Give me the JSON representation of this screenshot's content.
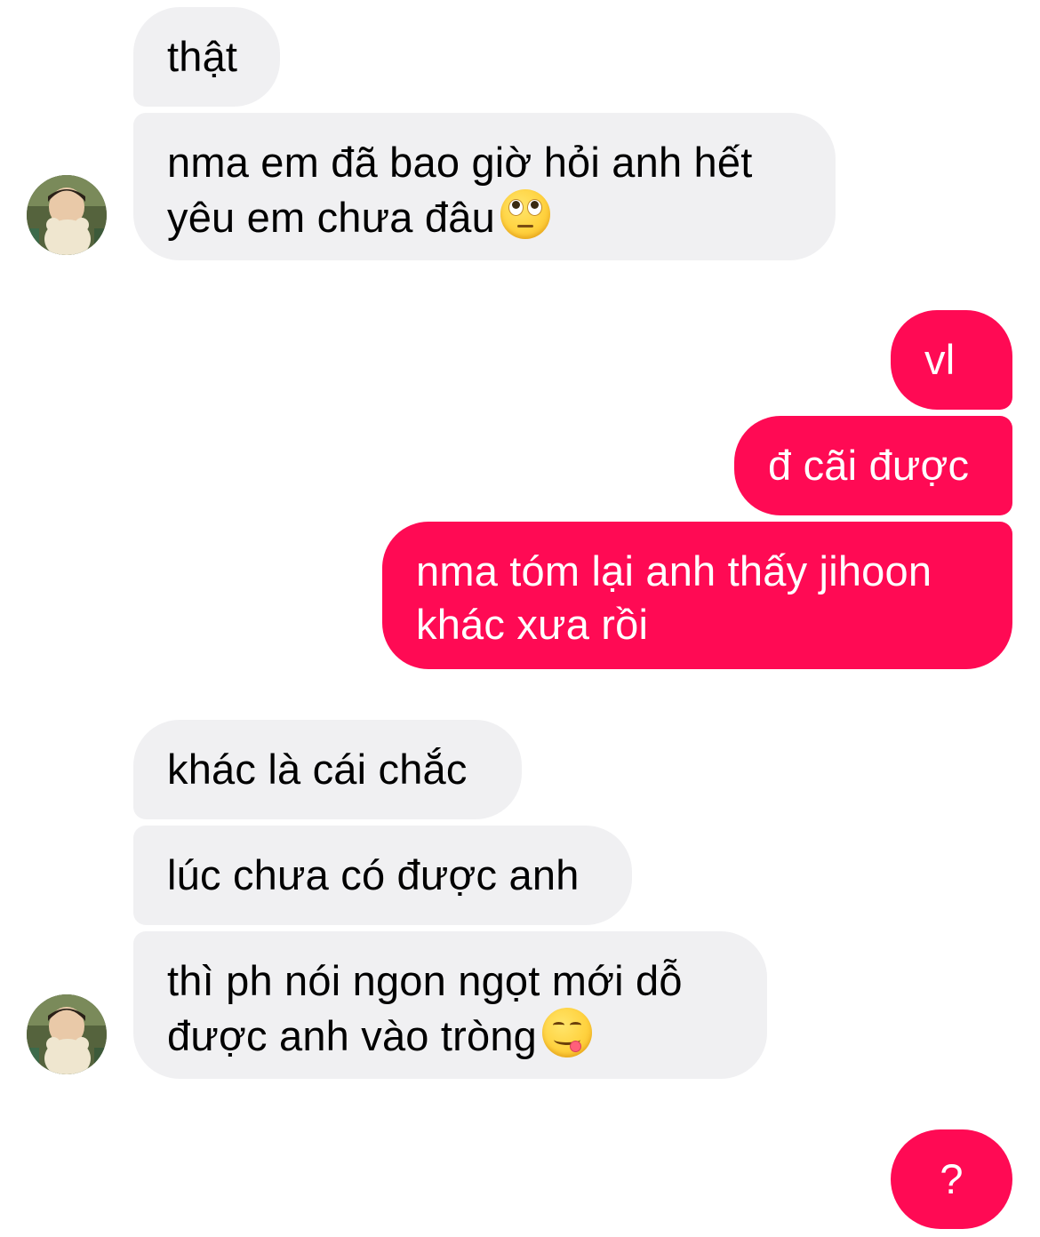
{
  "messages": [
    {
      "id": 1,
      "sender": "other",
      "text": "thật"
    },
    {
      "id": 2,
      "sender": "other",
      "line1": "nma em đã bao giờ hỏi anh hết",
      "line2": "yêu em chưa đâu",
      "emoji": "face-with-rolling-eyes"
    },
    {
      "id": 3,
      "sender": "me",
      "text": "vl"
    },
    {
      "id": 4,
      "sender": "me",
      "text": "đ cãi được"
    },
    {
      "id": 5,
      "sender": "me",
      "line1": "nma tóm lại anh thấy jihoon",
      "line2": "khác xưa rồi"
    },
    {
      "id": 6,
      "sender": "other",
      "text": "khác là cái chắc"
    },
    {
      "id": 7,
      "sender": "other",
      "text": "lúc chưa có được anh"
    },
    {
      "id": 8,
      "sender": "other",
      "line1": "thì ph nói ngon ngọt mới dỗ",
      "line2": "được anh vào tròng",
      "emoji": "face-savoring-food"
    },
    {
      "id": 9,
      "sender": "me",
      "text": "?"
    }
  ],
  "colors": {
    "incoming_bubble": "#f0f0f2",
    "outgoing_bubble": "#ff0a54",
    "incoming_text": "#000000",
    "outgoing_text": "#ffffff"
  },
  "icons": {
    "avatar": "contact-avatar-photo",
    "emoji_1": "face-with-rolling-eyes",
    "emoji_2": "face-savoring-food"
  }
}
